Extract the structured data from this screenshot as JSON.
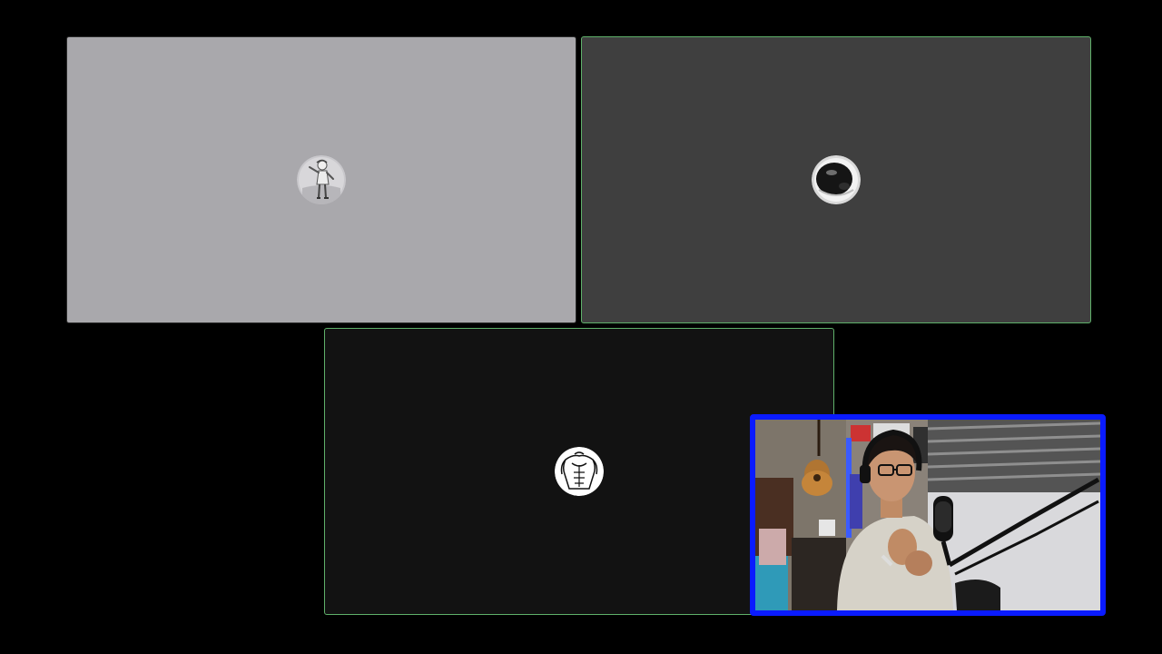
{
  "window": {
    "background": "#000000"
  },
  "participants": [
    {
      "id": "participant-1",
      "tile_color": "#a9a8ac",
      "speaking": false,
      "avatar": "cartoon-figure-avatar"
    },
    {
      "id": "participant-2",
      "tile_color": "#3f3f3f",
      "speaking": true,
      "avatar": "dark-sphere-avatar",
      "border_color": "#5fb06a"
    },
    {
      "id": "participant-3",
      "tile_color": "#121212",
      "speaking": true,
      "avatar": "muscular-torso-avatar",
      "border_color": "#5fb06a"
    }
  ],
  "self_view": {
    "border_color": "#0a1bff",
    "content": "webcam-video-feed"
  }
}
